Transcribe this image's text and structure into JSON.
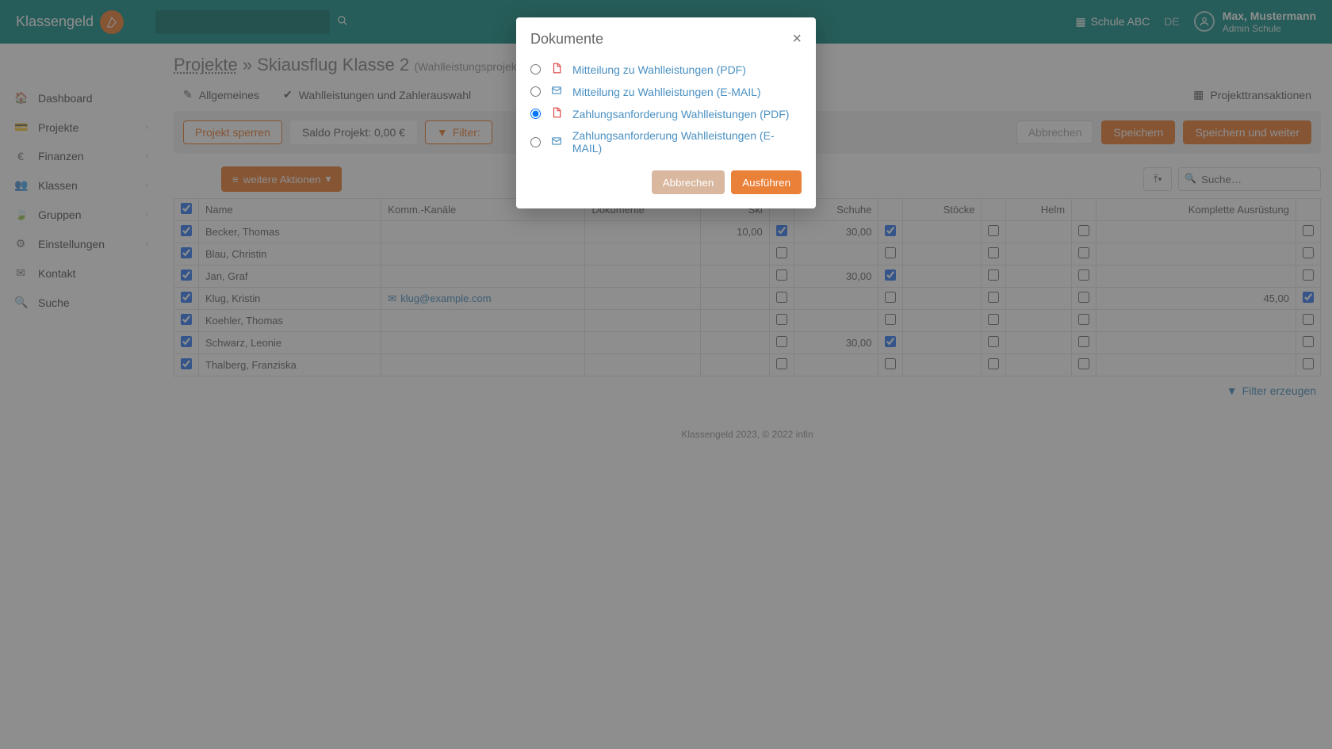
{
  "topbar": {
    "logo": "Klassengeld",
    "school": "Schule ABC",
    "lang": "DE",
    "user_name": "Max, Mustermann",
    "user_role": "Admin Schule"
  },
  "sidebar": {
    "items": [
      {
        "icon": "home",
        "label": "Dashboard",
        "expandable": false
      },
      {
        "icon": "card",
        "label": "Projekte",
        "expandable": true
      },
      {
        "icon": "euro",
        "label": "Finanzen",
        "expandable": true
      },
      {
        "icon": "group",
        "label": "Klassen",
        "expandable": true
      },
      {
        "icon": "leaf",
        "label": "Gruppen",
        "expandable": true
      },
      {
        "icon": "gear",
        "label": "Einstellungen",
        "expandable": true
      },
      {
        "icon": "mail",
        "label": "Kontakt",
        "expandable": false
      },
      {
        "icon": "search",
        "label": "Suche",
        "expandable": false
      }
    ]
  },
  "breadcrumb": {
    "root": "Projekte",
    "sep": " » ",
    "current": "Skiausflug Klasse 2",
    "sub": "(Wahlleistungsprojekt)"
  },
  "tabs": [
    {
      "icon": "pencil",
      "label": "Allgemeines"
    },
    {
      "icon": "check",
      "label": "Wahlleistungen und Zahlerauswahl"
    },
    {
      "icon": "table",
      "label": "Projekttransaktionen"
    }
  ],
  "action_bar": {
    "lock": "Projekt sperren",
    "saldo": "Saldo Projekt: 0,00 €",
    "filter": "Filter:",
    "cancel": "Abbrechen",
    "save": "Speichern",
    "save_next": "Speichern und weiter"
  },
  "toolbar": {
    "more_actions": "weitere Aktionen",
    "search_placeholder": "Suche…"
  },
  "table": {
    "headers": [
      "",
      "Name",
      "Komm.-Kanäle",
      "Dokumente",
      "Ski",
      "",
      "Schuhe",
      "",
      "Stöcke",
      "",
      "Helm",
      "",
      "Komplette Ausrüstung",
      ""
    ],
    "rows": [
      {
        "checked": true,
        "name": "Becker, Thomas",
        "komm": "",
        "dok": "",
        "ski": "10,00",
        "ski_cb": true,
        "schuhe": "30,00",
        "schuhe_cb": true,
        "stoecke": "",
        "stoecke_cb": false,
        "helm": "",
        "helm_cb": false,
        "komplett": "",
        "komplett_cb": false
      },
      {
        "checked": true,
        "name": "Blau, Christin",
        "komm": "",
        "dok": "",
        "ski": "",
        "ski_cb": false,
        "schuhe": "",
        "schuhe_cb": false,
        "stoecke": "",
        "stoecke_cb": false,
        "helm": "",
        "helm_cb": false,
        "komplett": "",
        "komplett_cb": false
      },
      {
        "checked": true,
        "name": "Jan, Graf",
        "komm": "",
        "dok": "",
        "ski": "",
        "ski_cb": false,
        "schuhe": "30,00",
        "schuhe_cb": true,
        "stoecke": "",
        "stoecke_cb": false,
        "helm": "",
        "helm_cb": false,
        "komplett": "",
        "komplett_cb": false
      },
      {
        "checked": true,
        "name": "Klug, Kristin",
        "komm": "klug@example.com",
        "dok": "",
        "ski": "",
        "ski_cb": false,
        "schuhe": "",
        "schuhe_cb": false,
        "stoecke": "",
        "stoecke_cb": false,
        "helm": "",
        "helm_cb": false,
        "komplett": "45,00",
        "komplett_cb": true
      },
      {
        "checked": true,
        "name": "Koehler, Thomas",
        "komm": "",
        "dok": "",
        "ski": "",
        "ski_cb": false,
        "schuhe": "",
        "schuhe_cb": false,
        "stoecke": "",
        "stoecke_cb": false,
        "helm": "",
        "helm_cb": false,
        "komplett": "",
        "komplett_cb": false
      },
      {
        "checked": true,
        "name": "Schwarz, Leonie",
        "komm": "",
        "dok": "",
        "ski": "",
        "ski_cb": false,
        "schuhe": "30,00",
        "schuhe_cb": true,
        "stoecke": "",
        "stoecke_cb": false,
        "helm": "",
        "helm_cb": false,
        "komplett": "",
        "komplett_cb": false
      },
      {
        "checked": true,
        "name": "Thalberg, Franziska",
        "komm": "",
        "dok": "",
        "ski": "",
        "ski_cb": false,
        "schuhe": "",
        "schuhe_cb": false,
        "stoecke": "",
        "stoecke_cb": false,
        "helm": "",
        "helm_cb": false,
        "komplett": "",
        "komplett_cb": false
      }
    ]
  },
  "filter_link": "Filter erzeugen",
  "footer": "Klassengeld 2023, © 2022 infin",
  "modal": {
    "title": "Dokumente",
    "options": [
      {
        "type": "pdf",
        "label": "Mitteilung zu Wahlleistungen (PDF)",
        "checked": false
      },
      {
        "type": "mail",
        "label": "Mitteilung zu Wahlleistungen (E-MAIL)",
        "checked": false
      },
      {
        "type": "pdf",
        "label": "Zahlungsanforderung Wahlleistungen (PDF)",
        "checked": true
      },
      {
        "type": "mail",
        "label": "Zahlungsanforderung Wahlleistungen (E-MAIL)",
        "checked": false
      }
    ],
    "cancel": "Abbrechen",
    "execute": "Ausführen"
  }
}
